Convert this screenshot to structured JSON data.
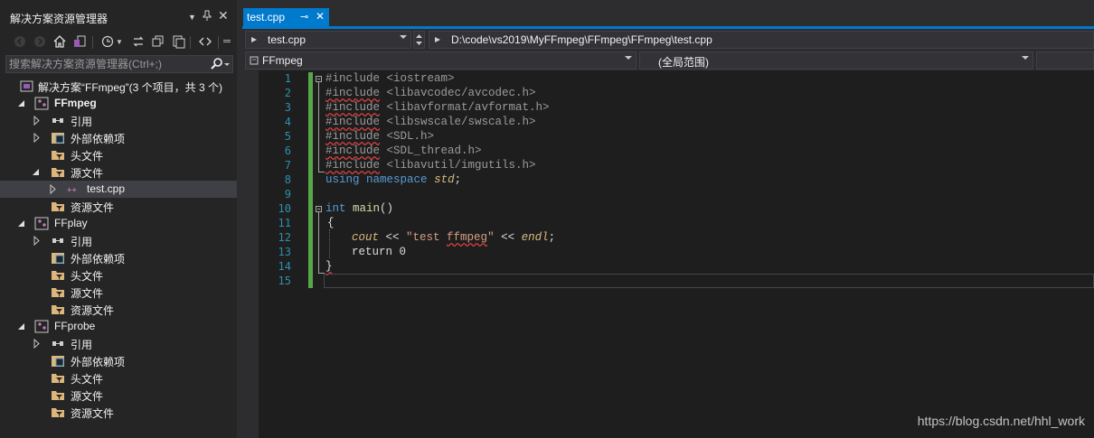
{
  "solution_explorer": {
    "title": "解决方案资源管理器",
    "search_placeholder": "搜索解决方案资源管理器(Ctrl+;)",
    "solution_label": "解决方案“FFmpeg”(3 个项目，共 3 个)",
    "project1": "FFmpeg",
    "project2": "FFplay",
    "project3": "FFprobe",
    "references": "引用",
    "external_deps": "外部依赖项",
    "header_files": "头文件",
    "source_files": "源文件",
    "resource_files": "资源文件",
    "test_file": "test.cpp"
  },
  "editor": {
    "tab_label": "test.cpp",
    "file_combo": "test.cpp",
    "path": "D:\\code\\vs2019\\MyFFmpeg\\FFmpeg\\FFmpeg\\test.cpp",
    "project_combo": "FFmpeg",
    "scope_combo": "(全局范围)",
    "line_numbers": [
      "1",
      "2",
      "3",
      "4",
      "5",
      "6",
      "7",
      "8",
      "9",
      "10",
      "11",
      "12",
      "13",
      "14",
      "15"
    ],
    "lines": {
      "l1": [
        "#include ",
        "<iostream>"
      ],
      "l2": [
        "#include",
        " <libavcodec/avcodec.h>"
      ],
      "l3": [
        "#include",
        " <libavformat/avformat.h>"
      ],
      "l4": [
        "#include",
        " <libswscale/swscale.h>"
      ],
      "l5": [
        "#include",
        " <SDL.h>"
      ],
      "l6": [
        "#include",
        " <SDL_thread.h>"
      ],
      "l7": [
        "#include",
        " <libavutil/imgutils.h>"
      ],
      "l8": [
        "using",
        " ",
        "namespace",
        " ",
        "std",
        ";"
      ],
      "l10": [
        "int",
        " ",
        "main",
        "()"
      ],
      "l11": [
        "{"
      ],
      "l12": [
        "cout",
        " << ",
        "\"test ",
        "ffmpeg",
        "\"",
        " << ",
        "endl",
        ";"
      ],
      "l13": [
        "return",
        " 0"
      ],
      "l14": [
        "}"
      ]
    }
  },
  "watermark": "https://blog.csdn.net/hhl_work",
  "colors": {
    "accent": "#007acc",
    "keyword": "#569cd6",
    "line_number": "#2b91af",
    "change_bar": "#57a64a"
  }
}
